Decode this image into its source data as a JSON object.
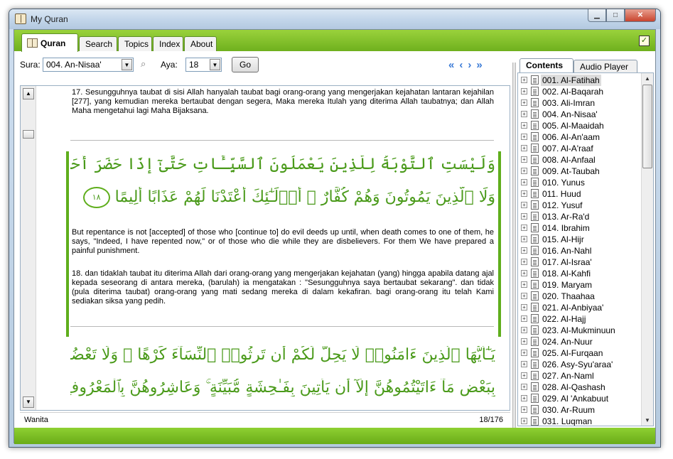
{
  "window": {
    "title": "My Quran"
  },
  "tabs": [
    "Quran",
    "Search",
    "Topics",
    "Index",
    "About"
  ],
  "toolbar": {
    "sura_label": "Sura:",
    "sura_value": "004. An-Nisaa'",
    "aya_label": "Aya:",
    "aya_value": "18",
    "go_label": "Go"
  },
  "reader": {
    "verse17_indo": "17. Sesungguhnya taubat di sisi Allah hanyalah taubat bagi orang-orang yang mengerjakan kejahatan lantaran kejahilan [277], yang kemudian mereka bertaubat dengan segera, Maka mereka Itulah yang diterima Allah taubatnya; dan Allah Maha mengetahui lagi Maha Bijaksana.",
    "verse18_arabic_line1": "وَلَيْسَتِ ٱلتَّوْبَةُ لِلَّذِينَ يَعْمَلُونَ ٱلسَّيِّـَٔاتِ حَتَّىٰٓ إِذَا حَضَرَ أَحَدَهُمُ ٱلْمَوْتُ قَالَ إِنِّى تُبْتُ ٱلْـَٔـٰنَ",
    "verse18_arabic_line2": "وَلَا ٱلَّذِينَ يَمُوتُونَ وَهُمْ كُفَّارٌ ۚ أُو۟لَـٰٓئِكَ أَعْتَدْنَا لَهُمْ عَذَابًا أَلِيمًا",
    "verse18_number": "١٨",
    "verse18_english": "But repentance is not [accepted] of those who [continue to] do evil deeds up until, when death comes to one of them, he says, \"Indeed, I have repented now,\" or of those who die while they are disbelievers. For them We have prepared a painful punishment.",
    "verse18_indo": "18. dan tidaklah taubat itu diterima Allah dari orang-orang yang mengerjakan kejahatan (yang) hingga apabila datang ajal kepada seseorang di antara mereka, (barulah) ia mengatakan : \"Sesungguhnya saya bertaubat sekarang\". dan tidak (pula diterima taubat) orang-orang yang mati sedang mereka di dalam kekafiran. bagi orang-orang itu telah Kami sediakan siksa yang pedih.",
    "verse19_arabic_line1": "يَـٰٓأَيُّهَا ٱلَّذِينَ ءَامَنُوا۟ لَا يَحِلُّ لَكُمْ أَن تَرِثُوا۟ ٱلنِّسَآءَ كَرْهًا ۖ وَلَا تَعْضُلُوهُنَّ لِتَذْهَبُوا۟",
    "verse19_arabic_line2": "بِبَعْضِ مَآ ءَاتَيْتُمُوهُنَّ إِلَّآ أَن يَأْتِينَ بِفَـٰحِشَةٍ مُّبَيِّنَةٍ ۚ وَعَاشِرُوهُنَّ بِٱلْمَعْرُوفِ ۚ فَإِن"
  },
  "status": {
    "left": "Wanita",
    "right": "18/176"
  },
  "side_tabs": [
    "Contents",
    "Audio Player"
  ],
  "suras": [
    "001. Al-Fatihah",
    "002. Al-Baqarah",
    "003. Ali-Imran",
    "004. An-Nisaa'",
    "005. Al-Maaidah",
    "006. Al-An'aam",
    "007. Al-A'raaf",
    "008. Al-Anfaal",
    "009. At-Taubah",
    "010. Yunus",
    "011. Huud",
    "012. Yusuf",
    "013. Ar-Ra'd",
    "014. Ibrahim",
    "015. Al-Hijr",
    "016. An-Nahl",
    "017. Al-Israa'",
    "018. Al-Kahfi",
    "019. Maryam",
    "020. Thaahaa",
    "021. Al-Anbiyaa'",
    "022. Al-Hajj",
    "023. Al-Mukminuun",
    "024. An-Nuur",
    "025. Al-Furqaan",
    "026. Asy-Syu'araa'",
    "027. An-Naml",
    "028. Al-Qashash",
    "029. Al 'Ankabuut",
    "030. Ar-Ruum",
    "031. Luqman"
  ]
}
